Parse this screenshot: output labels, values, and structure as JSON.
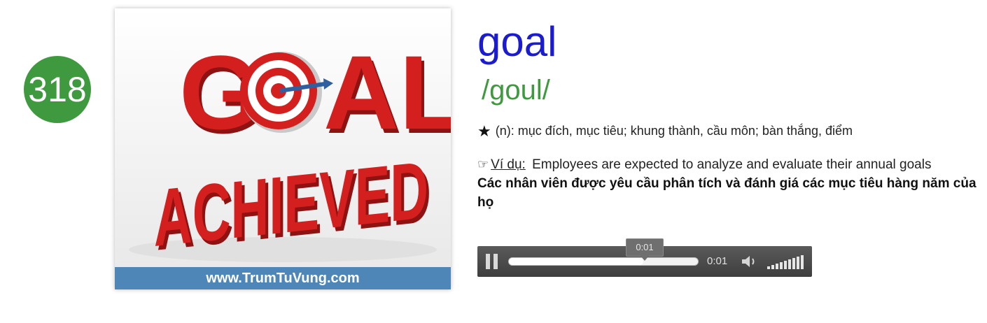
{
  "entry": {
    "number": "318",
    "word": "goal",
    "phonetic": "/goul/",
    "definition": "(n): mục đích, mục tiêu; khung thành, cầu môn; bàn thắng, điểm",
    "example_label": "Ví dụ:",
    "example_sentence": "Employees are expected to analyze and evaluate their annual goals",
    "example_translation": "Các nhân viên được yêu cầu phân tích và đánh giá các mục tiêu hàng năm của họ"
  },
  "image": {
    "headline_line1": "GOAL",
    "headline_line2": "ACHIEVED",
    "website": "www.TrumTuVung.com"
  },
  "player": {
    "tooltip_time": "0:01",
    "current_time": "0:01",
    "progress": 0.71,
    "volume": 1.0
  },
  "icons": {
    "definition_icon": "star-icon",
    "example_icon": "pointing-hand-icon",
    "play_state_icon": "pause-icon",
    "volume_icon": "speaker-icon"
  },
  "colors": {
    "badge": "#3f9a3f",
    "word": "#1c1ccf",
    "phonetic": "#3f9a3f",
    "image_footer": "#4f86b8",
    "headline_red": "#d41f1f"
  }
}
